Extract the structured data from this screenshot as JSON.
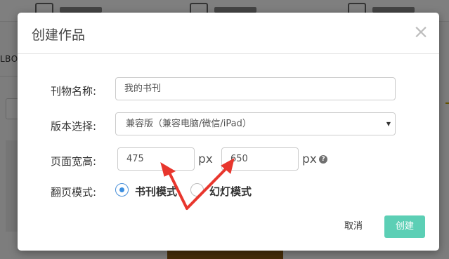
{
  "background": {
    "left_text": "LBO"
  },
  "modal": {
    "title": "创建作品",
    "close_symbol": "×",
    "fields": {
      "name_label": "刊物名称:",
      "name_value": "我的书刊",
      "version_label": "版本选择:",
      "version_value": "兼容版（兼容电脑/微信/iPad）",
      "size_label": "页面宽高:",
      "width_value": "475",
      "height_value": "650",
      "unit": "px",
      "help_symbol": "?",
      "mode_label": "翻页模式:",
      "mode_options": [
        {
          "label": "书刊模式",
          "checked": true
        },
        {
          "label": "幻灯模式",
          "checked": false
        }
      ]
    },
    "buttons": {
      "cancel": "取消",
      "create": "创建"
    },
    "colors": {
      "accent": "#5ccfb5",
      "radio": "#3b8ee0",
      "arrow": "#e8362d"
    }
  }
}
